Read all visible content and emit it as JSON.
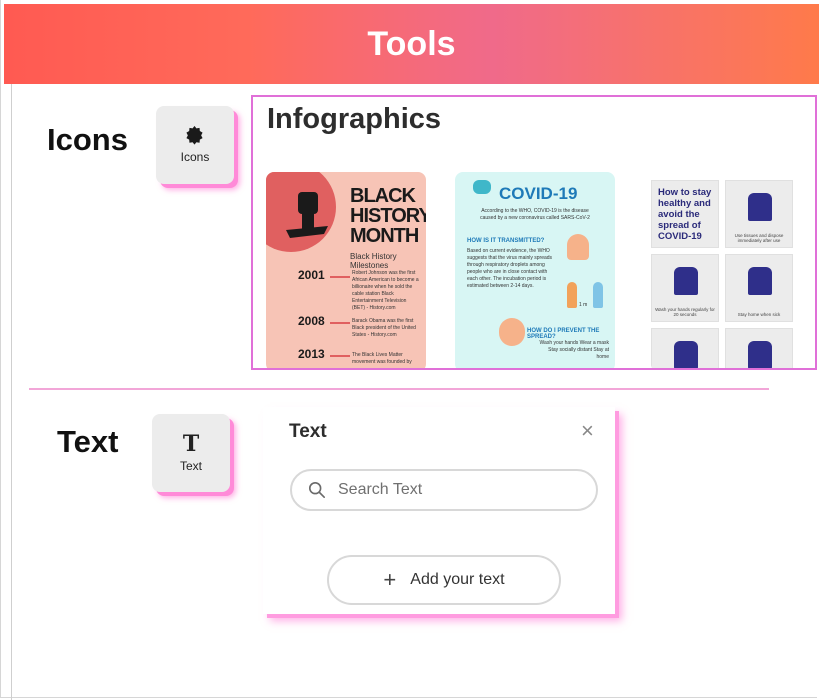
{
  "header": {
    "title": "Tools"
  },
  "icons_row": {
    "label": "Icons",
    "button_label": "Icons",
    "button_icon": "badge-icon"
  },
  "infographics": {
    "title": "Infographics",
    "black_history": {
      "title_line1": "BLACK",
      "title_line2": "HISTORY",
      "title_line3": "MONTH",
      "subtitle": "Black History Milestones",
      "entries": [
        {
          "year": "2001",
          "text": "Robert Johnson was the first African American to become a billionaire when he sold the cable station Black Entertainment Television (BET) - History.com"
        },
        {
          "year": "2008",
          "text": "Barack Obama was the first Black president of the United States - History.com"
        },
        {
          "year": "2013",
          "text": "The Black Lives Matter movement was founded by"
        }
      ]
    },
    "covid": {
      "title": "COVID-19",
      "intro": "According to the WHO, COVID-19 is the disease caused by a new coronavirus called SARS-CoV-2",
      "q1": "HOW IS IT TRANSMITTED?",
      "a1": "Based on current evidence, the WHO suggests that the virus mainly spreads through respiratory droplets among people who are in close contact with each other. The incubation period is estimated between 2-14 days.",
      "distance": "1 m",
      "q2": "HOW DO I PREVENT THE SPREAD?",
      "a2": "Wash your hands Wear a mask Stay socially distant Stay at home"
    },
    "healthy": {
      "title": "How to stay healthy and avoid the spread of COVID-19",
      "tiles": [
        "Use tissues and dispose immediately after use",
        "Wash your hands regularly for 20 seconds",
        "Stay home when sick"
      ]
    }
  },
  "text_row": {
    "label": "Text",
    "button_label": "Text",
    "button_glyph": "T"
  },
  "text_panel": {
    "title": "Text",
    "close_glyph": "×",
    "search_placeholder": "Search Text",
    "add_label": "Add your text",
    "add_glyph": "+"
  },
  "colors": {
    "accent_pink": "#e070d8",
    "shadow_pink": "#ff8ad8"
  }
}
